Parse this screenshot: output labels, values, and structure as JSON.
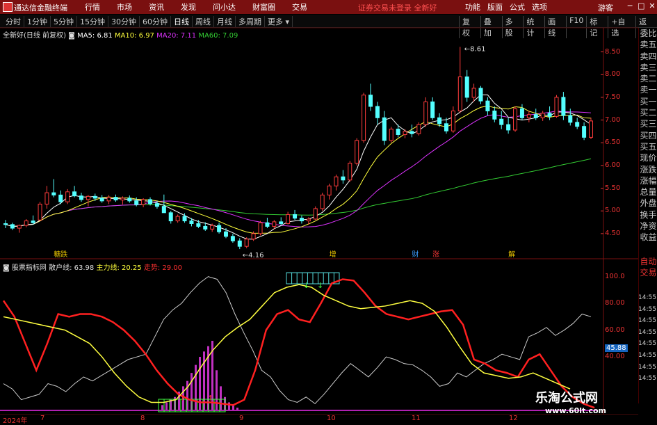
{
  "titlebar": {
    "app_title": "通达信金融终端",
    "menu": [
      "行情",
      "市场",
      "资讯",
      "发现",
      "问小达",
      "财富圈",
      "交易"
    ],
    "notice": "证券交易未登录",
    "stock_name": "全新好",
    "right_menu": [
      "功能",
      "版面",
      "公式",
      "选项"
    ],
    "guest": "游客",
    "win_buttons": [
      "─",
      "□",
      "✕"
    ]
  },
  "periodbar": {
    "periods": [
      "分时",
      "1分钟",
      "5分钟",
      "15分钟",
      "30分钟",
      "60分钟",
      "日线",
      "周线",
      "月线",
      "多周期",
      "更多 ▾"
    ],
    "active_period": "日线",
    "tools": [
      "复权",
      "叠加",
      "多股",
      "统计",
      "画线",
      "F10",
      "标记",
      "+自选",
      "返回"
    ]
  },
  "main_header": {
    "label": "全新好(日线 前复权)",
    "ma5": "MA5: 6.81",
    "ma10": "MA10: 6.97",
    "ma20": "MA20: 7.11",
    "ma60": "MA60: 7.09"
  },
  "sub_header": {
    "label": "股票指标网",
    "retail": "散户线: 63.98",
    "main": "主力线: 20.25",
    "trend": "走势: 29.00"
  },
  "colors": {
    "up": "#ff3c3c",
    "down": "#54ffff",
    "ma5": "#ffffff",
    "ma10": "#ffff3c",
    "ma20": "#dd33ff",
    "ma60": "#33cc33",
    "axis": "#e33333",
    "retail_line": "#cccccc",
    "main_line": "#ff2020",
    "trend_line": "#ffff40"
  },
  "price_axis": [
    "8.50",
    "8.00",
    "7.50",
    "7.00",
    "6.50",
    "6.00",
    "5.50",
    "5.00",
    "4.50"
  ],
  "osc_axis": [
    "100.0",
    "80.00",
    "60.00",
    "40.00"
  ],
  "sidebar_items": [
    "委比",
    "卖五",
    "卖四",
    "卖三",
    "卖二",
    "卖一",
    "买一",
    "买二",
    "买三",
    "买四",
    "买五",
    "现价",
    "涨跌",
    "涨幅",
    "总量",
    "外盘",
    "换手",
    "净资",
    "收益"
  ],
  "sidebar_lower": [
    "自动",
    "交易"
  ],
  "time_col": [
    "14:55",
    "14:55",
    "14:55",
    "14:55",
    "14:55",
    "14:55",
    "14:55",
    "14:55"
  ],
  "osc_value_tag": "45.88",
  "x_axis": {
    "year": "2024年",
    "months": [
      "7",
      "8",
      "9",
      "10",
      "11",
      "12"
    ]
  },
  "annotations": {
    "high": "8.61",
    "low": "4.16",
    "markers": [
      "糖跌",
      "增",
      "财",
      "涨",
      "解"
    ]
  },
  "watermark": {
    "line1": "乐淘公式网",
    "line2": "www.60lt.com"
  },
  "chart_data": [
    {
      "type": "candlestick",
      "title": "全新好(日线 前复权)",
      "ylim": [
        4.1,
        8.8
      ],
      "ohlc": [
        [
          4.72,
          4.8,
          4.62,
          4.7
        ],
        [
          4.7,
          4.74,
          4.58,
          4.62
        ],
        [
          4.62,
          4.7,
          4.52,
          4.68
        ],
        [
          4.68,
          4.82,
          4.64,
          4.78
        ],
        [
          4.78,
          4.9,
          4.7,
          4.74
        ],
        [
          4.8,
          5.2,
          4.78,
          5.15
        ],
        [
          5.15,
          5.55,
          5.05,
          5.4
        ],
        [
          5.4,
          5.7,
          5.3,
          5.35
        ],
        [
          5.35,
          5.45,
          5.15,
          5.2
        ],
        [
          5.2,
          5.48,
          5.15,
          5.42
        ],
        [
          5.42,
          5.55,
          5.3,
          5.33
        ],
        [
          5.33,
          5.4,
          5.2,
          5.25
        ],
        [
          5.25,
          5.35,
          5.1,
          5.32
        ],
        [
          5.32,
          5.38,
          5.22,
          5.28
        ],
        [
          5.28,
          5.35,
          5.18,
          5.22
        ],
        [
          5.22,
          5.35,
          5.15,
          5.3
        ],
        [
          5.3,
          5.36,
          5.2,
          5.24
        ],
        [
          5.24,
          5.32,
          5.14,
          5.28
        ],
        [
          5.28,
          5.34,
          5.18,
          5.22
        ],
        [
          5.22,
          5.3,
          5.1,
          5.14
        ],
        [
          5.14,
          5.28,
          5.08,
          5.25
        ],
        [
          5.25,
          5.3,
          5.12,
          5.16
        ],
        [
          5.16,
          5.22,
          5.05,
          5.1
        ],
        [
          5.1,
          5.36,
          5.05,
          4.96
        ],
        [
          4.96,
          5.0,
          4.72,
          4.78
        ],
        [
          4.78,
          4.92,
          4.74,
          4.88
        ],
        [
          4.88,
          4.95,
          4.74,
          4.78
        ],
        [
          4.78,
          4.84,
          4.66,
          4.72
        ],
        [
          4.72,
          4.8,
          4.62,
          4.66
        ],
        [
          4.66,
          4.75,
          4.56,
          4.6
        ],
        [
          4.6,
          4.72,
          4.54,
          4.68
        ],
        [
          4.68,
          4.74,
          4.5,
          4.54
        ],
        [
          4.54,
          4.62,
          4.4,
          4.44
        ],
        [
          4.44,
          4.5,
          4.3,
          4.34
        ],
        [
          4.34,
          4.4,
          4.16,
          4.22
        ],
        [
          4.22,
          4.42,
          4.18,
          4.38
        ],
        [
          4.38,
          4.55,
          4.34,
          4.5
        ],
        [
          4.5,
          4.78,
          4.46,
          4.74
        ],
        [
          4.74,
          4.85,
          4.62,
          4.66
        ],
        [
          4.66,
          4.8,
          4.6,
          4.76
        ],
        [
          4.76,
          4.86,
          4.68,
          4.72
        ],
        [
          4.72,
          4.98,
          4.7,
          4.92
        ],
        [
          4.92,
          5.02,
          4.8,
          4.84
        ],
        [
          4.84,
          4.9,
          4.72,
          4.78
        ],
        [
          4.78,
          4.86,
          4.7,
          4.82
        ],
        [
          4.82,
          5.1,
          4.8,
          5.05
        ],
        [
          5.05,
          5.4,
          5.0,
          5.35
        ],
        [
          5.35,
          5.6,
          5.25,
          5.55
        ],
        [
          5.55,
          5.8,
          5.45,
          5.75
        ],
        [
          5.75,
          5.9,
          5.6,
          5.68
        ],
        [
          5.68,
          6.1,
          5.64,
          6.05
        ],
        [
          6.05,
          6.6,
          6.0,
          6.55
        ],
        [
          6.55,
          7.6,
          6.5,
          7.55
        ],
        [
          7.55,
          7.8,
          7.2,
          7.3
        ],
        [
          7.3,
          7.4,
          6.9,
          7.05
        ],
        [
          7.05,
          7.2,
          6.45,
          6.55
        ],
        [
          6.55,
          6.85,
          6.5,
          6.8
        ],
        [
          6.8,
          6.9,
          6.62,
          6.68
        ],
        [
          6.68,
          6.8,
          6.6,
          6.75
        ],
        [
          6.75,
          6.9,
          6.62,
          6.7
        ],
        [
          6.7,
          6.95,
          6.66,
          6.9
        ],
        [
          6.9,
          7.5,
          6.85,
          7.4
        ],
        [
          7.4,
          7.5,
          7.0,
          7.05
        ],
        [
          7.05,
          7.15,
          6.85,
          6.92
        ],
        [
          6.92,
          7.05,
          6.7,
          6.76
        ],
        [
          6.76,
          7.3,
          6.72,
          7.2
        ],
        [
          7.2,
          8.61,
          7.15,
          7.95
        ],
        [
          7.95,
          8.1,
          7.4,
          7.5
        ],
        [
          7.5,
          7.8,
          7.4,
          7.7
        ],
        [
          7.7,
          7.75,
          7.35,
          7.42
        ],
        [
          7.42,
          7.5,
          7.1,
          7.2
        ],
        [
          7.2,
          7.3,
          6.95,
          7.02
        ],
        [
          7.02,
          7.2,
          6.8,
          6.9
        ],
        [
          6.9,
          7.05,
          6.7,
          6.78
        ],
        [
          6.78,
          7.3,
          6.74,
          7.25
        ],
        [
          7.25,
          7.35,
          7.0,
          7.05
        ],
        [
          7.05,
          7.2,
          6.95,
          7.12
        ],
        [
          7.12,
          7.25,
          7.0,
          7.05
        ],
        [
          7.05,
          7.2,
          6.98,
          7.15
        ],
        [
          7.15,
          7.3,
          7.0,
          7.08
        ],
        [
          7.08,
          7.55,
          7.05,
          7.5
        ],
        [
          7.5,
          7.62,
          7.0,
          7.1
        ],
        [
          7.1,
          7.25,
          6.88,
          6.95
        ],
        [
          6.95,
          7.05,
          6.8,
          6.86
        ],
        [
          6.86,
          6.95,
          6.56,
          6.62
        ],
        [
          6.62,
          7.05,
          6.58,
          6.98
        ]
      ]
    },
    {
      "type": "line",
      "title": "股票指标网",
      "ylim": [
        0,
        105
      ],
      "series": [
        {
          "name": "散户线",
          "values": [
            20,
            16,
            8,
            10,
            12,
            20,
            18,
            14,
            20,
            25,
            22,
            26,
            30,
            34,
            38,
            40,
            42,
            55,
            68,
            75,
            80,
            88,
            95,
            100,
            98,
            88,
            72,
            58,
            45,
            30,
            25,
            15,
            8,
            6,
            10,
            5,
            12,
            20,
            28,
            35,
            30,
            25,
            32,
            40,
            38,
            35,
            34,
            30,
            25,
            18,
            20,
            28,
            25,
            30,
            35,
            38,
            42,
            40,
            38,
            55,
            58,
            62,
            56,
            60,
            65,
            72,
            70
          ]
        },
        {
          "name": "主力线",
          "values": [
            82,
            70,
            50,
            30,
            50,
            72,
            70,
            72,
            72,
            70,
            66,
            60,
            52,
            42,
            30,
            20,
            12,
            8,
            6,
            6,
            5,
            4,
            8,
            30,
            60,
            72,
            75,
            68,
            66,
            80,
            95,
            98,
            97,
            88,
            78,
            72,
            70,
            68,
            70,
            72,
            74,
            75,
            64,
            38,
            35,
            30,
            28,
            25,
            38,
            42,
            30,
            18,
            10,
            5,
            2
          ]
        },
        {
          "name": "走势",
          "values": [
            70,
            68,
            66,
            64,
            62,
            60,
            55,
            50,
            40,
            28,
            18,
            10,
            6,
            6,
            8,
            18,
            32,
            45,
            55,
            62,
            68,
            78,
            88,
            92,
            94,
            92,
            86,
            82,
            78,
            76,
            77,
            78,
            80,
            82,
            80,
            74,
            62,
            48,
            35,
            28,
            26,
            24,
            25,
            28,
            24,
            20,
            16
          ]
        }
      ]
    }
  ]
}
